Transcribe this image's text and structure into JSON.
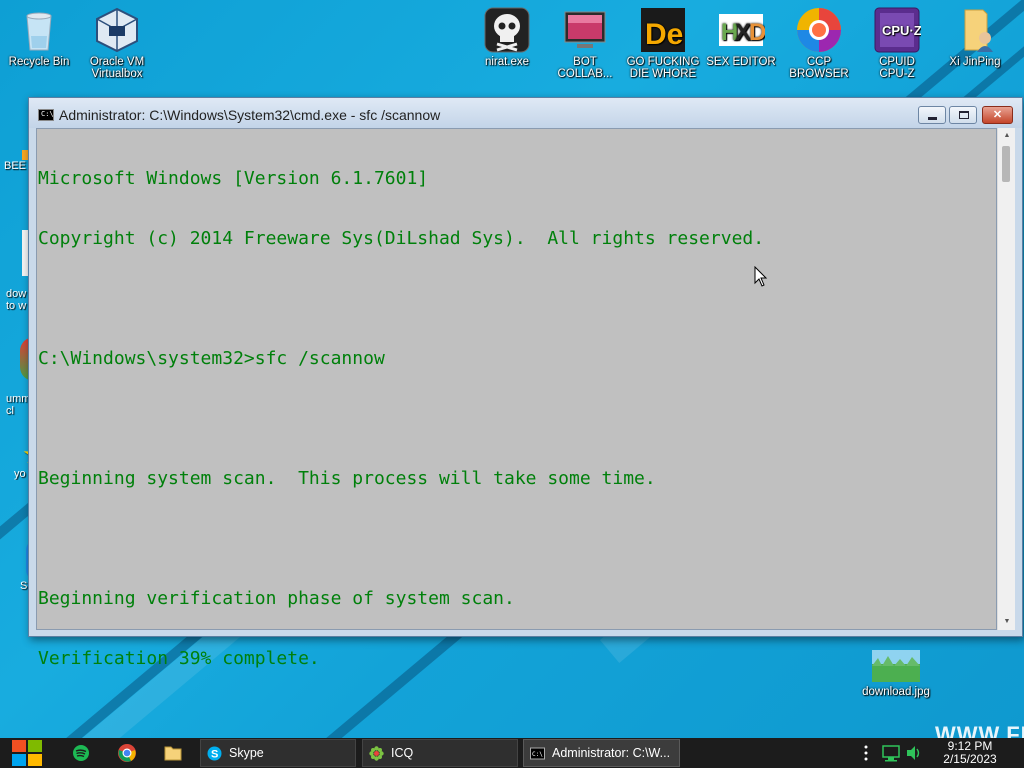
{
  "desktop": {
    "top_icons": [
      {
        "label": "Recycle Bin",
        "icon": "recycle-bin-icon"
      },
      {
        "label": "Oracle VM\nVirtualbox",
        "icon": "virtualbox-icon"
      },
      {
        "label": "nirat.exe",
        "icon": "skull-icon"
      },
      {
        "label": "BOT\nCOLLAB...",
        "icon": "monitor-icon"
      },
      {
        "label": "GO FUCKING\nDIE WHORE",
        "icon": "die-icon"
      },
      {
        "label": "SEX EDITOR",
        "icon": "hxd-icon"
      },
      {
        "label": "CCP\nBROWSER",
        "icon": "browser-icon"
      },
      {
        "label": "CPUID\nCPU-Z",
        "icon": "cpuz-icon"
      },
      {
        "label": "Xi JinPing",
        "icon": "folder-user-icon"
      }
    ],
    "left_partial": [
      "BEE",
      "dow\nto w",
      "umm\ncl",
      "yo",
      "S"
    ],
    "bottom_icon": {
      "label": "download.jpg",
      "icon": "image-file-icon"
    },
    "watermark": "WWW.FR"
  },
  "window": {
    "title": "Administrator: C:\\Windows\\System32\\cmd.exe - sfc  /scannow",
    "console_lines": [
      "Microsoft Windows [Version 6.1.7601]",
      "Copyright (c) 2014 Freeware Sys(DiLshad Sys).  All rights reserved.",
      "",
      "C:\\Windows\\system32>sfc /scannow",
      "",
      "Beginning system scan.  This process will take some time.",
      "",
      "Beginning verification phase of system scan.",
      "Verification 39% complete."
    ],
    "colors": {
      "text": "#00800b",
      "background": "#c0c0c0"
    }
  },
  "taskbar": {
    "tasks": [
      {
        "label": "Skype",
        "icon": "skype-icon"
      },
      {
        "label": "ICQ",
        "icon": "icq-icon"
      },
      {
        "label": "Administrator: C:\\W...",
        "icon": "cmd-icon"
      }
    ],
    "clock_time": "9:12 PM",
    "clock_date": "2/15/2023"
  }
}
